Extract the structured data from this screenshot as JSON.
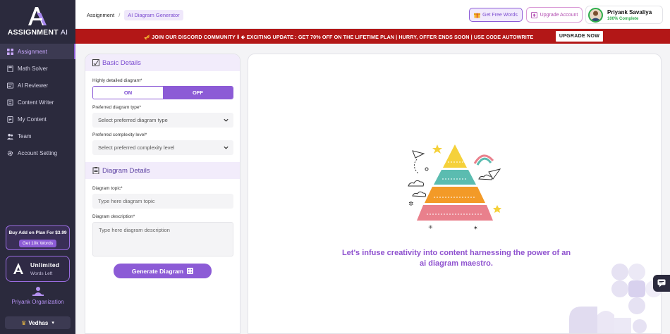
{
  "app": {
    "logo_text_main": "ASSIGNMENT",
    "logo_text_ai": "AI"
  },
  "sidebar": {
    "items": [
      {
        "label": "Assignment",
        "icon": "grid-icon",
        "active": true
      },
      {
        "label": "Math Solver",
        "icon": "calculator-icon",
        "active": false
      },
      {
        "label": "AI Reviewer",
        "icon": "reviewer-icon",
        "active": false
      },
      {
        "label": "Content Writer",
        "icon": "writer-icon",
        "active": false
      },
      {
        "label": "My Content",
        "icon": "folder-icon",
        "active": false
      },
      {
        "label": "Team",
        "icon": "team-icon",
        "active": false
      },
      {
        "label": "Account Setting",
        "icon": "gear-icon",
        "active": false
      }
    ],
    "promo": {
      "title": "Buy Add on Plan For $3.99",
      "button": "Get 10k Words"
    },
    "unlimited": {
      "title": "Unlimited",
      "subtitle": "Words Left"
    },
    "organization": "Priyank Organization",
    "workspace": "Vedhas"
  },
  "header": {
    "breadcrumb": [
      "Assignment",
      "AI Diagram Generator"
    ],
    "free_words_label": "Get Free Words",
    "upgrade_label": "Upgrade Account",
    "profile": {
      "name": "Priyank Savaliya",
      "status": "100% Complete"
    }
  },
  "banner": {
    "text_prefix": "🎺 JOIN OUR DISCORD COMMUNITY ‖ 🢀 EXCITING UPDATE : ",
    "text_highlight": "GET 70% OFF",
    "text_mid": " ON THE LIFETIME PLAN | HURRY, OFFER ENDS SOON | USE CODE ",
    "text_code": "AUTOWRITE",
    "button": "UPGRADE NOW"
  },
  "form": {
    "basic_title": "Basic Details",
    "detailed_label": "Highly detailed diagram*",
    "toggle_on": "ON",
    "toggle_off": "OFF",
    "toggle_selected": "OFF",
    "type_label": "Preferred diagram type*",
    "type_placeholder": "Select preferred diagram type",
    "complexity_label": "Preferred complexity level*",
    "complexity_placeholder": "Select preferred complexity level",
    "diagram_title": "Diagram Details",
    "topic_label": "Diagram topic*",
    "topic_placeholder": "Type here diagram topic",
    "description_label": "Diagram description*",
    "description_placeholder": "Type here diagram description",
    "generate_label": "Generate Diagram"
  },
  "canvas": {
    "tagline": "Let's infuse creativity into content harnessing the power of an ai diagram maestro."
  },
  "colors": {
    "accent": "#8c5bd6",
    "sidebar_bg": "#2b2a3d",
    "banner_bg": "#b31717",
    "success": "#2fae4d"
  }
}
